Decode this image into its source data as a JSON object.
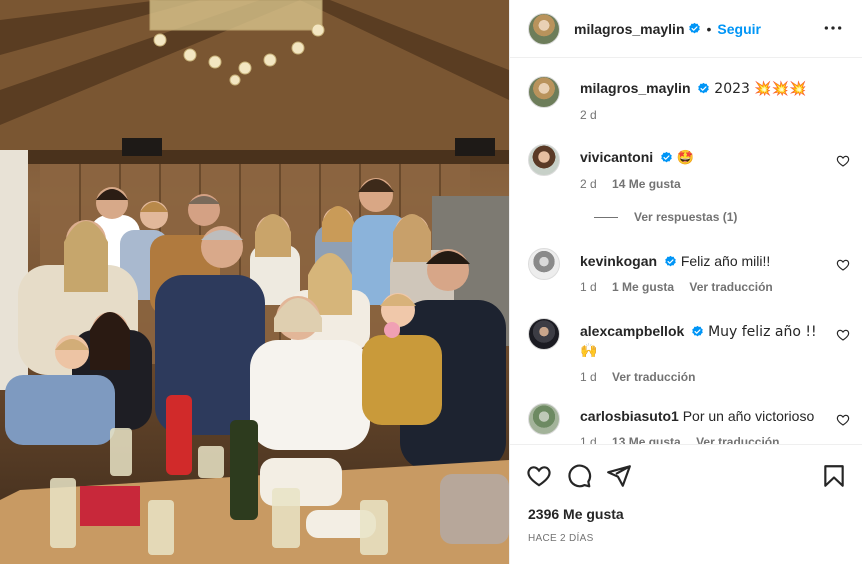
{
  "post": {
    "username": "milagros_maylin",
    "follow_label": "Seguir",
    "dot": "•",
    "caption": {
      "username": "milagros_maylin",
      "text": "2023 💥💥💥",
      "time": "2 d"
    },
    "likes": "2396 Me gusta",
    "posted_ago": "HACE 2 DÍAS"
  },
  "comments": [
    {
      "username": "vivicantoni",
      "text": "🤩",
      "time": "2 d",
      "likes": "14 Me gusta",
      "translate": "",
      "verified": true
    },
    {
      "username": "kevinkogan",
      "text": "Feliz año mili!!",
      "time": "1 d",
      "likes": "1 Me gusta",
      "translate": "Ver traducción",
      "verified": true
    },
    {
      "username": "alexcampbellok",
      "text": "Muy feliz año !! 🙌",
      "time": "1 d",
      "likes": "",
      "translate": "Ver traducción",
      "verified": true
    },
    {
      "username": "carlosbiasuto1",
      "text": "Por un año victorioso",
      "time": "1 d",
      "likes": "13 Me gusta",
      "translate": "Ver traducción",
      "verified": false
    }
  ],
  "replies_label": "Ver respuestas (1)",
  "icons": {
    "verified": "verified-badge-icon",
    "more": "more-options-icon",
    "like": "heart-icon",
    "comment": "comment-icon",
    "share": "share-icon",
    "save": "bookmark-icon"
  },
  "colors": {
    "accent": "#0095f6",
    "muted": "#737373",
    "text": "#262626"
  }
}
